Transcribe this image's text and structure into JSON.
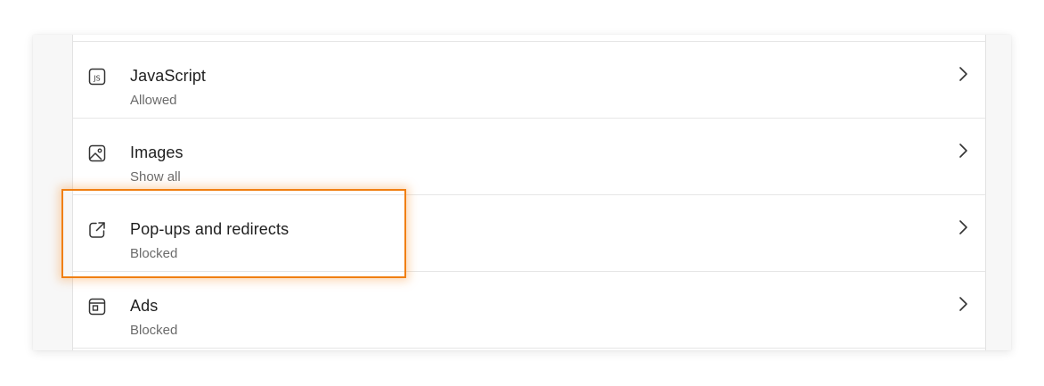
{
  "settings": {
    "items": [
      {
        "title": "JavaScript",
        "status": "Allowed",
        "icon": "javascript-icon"
      },
      {
        "title": "Images",
        "status": "Show all",
        "icon": "image-icon"
      },
      {
        "title": "Pop-ups and redirects",
        "status": "Blocked",
        "icon": "external-link-icon"
      },
      {
        "title": "Ads",
        "status": "Blocked",
        "icon": "ads-window-icon"
      }
    ],
    "highlighted_item": "Pop-ups and redirects",
    "highlight_color": "#f07f12"
  }
}
